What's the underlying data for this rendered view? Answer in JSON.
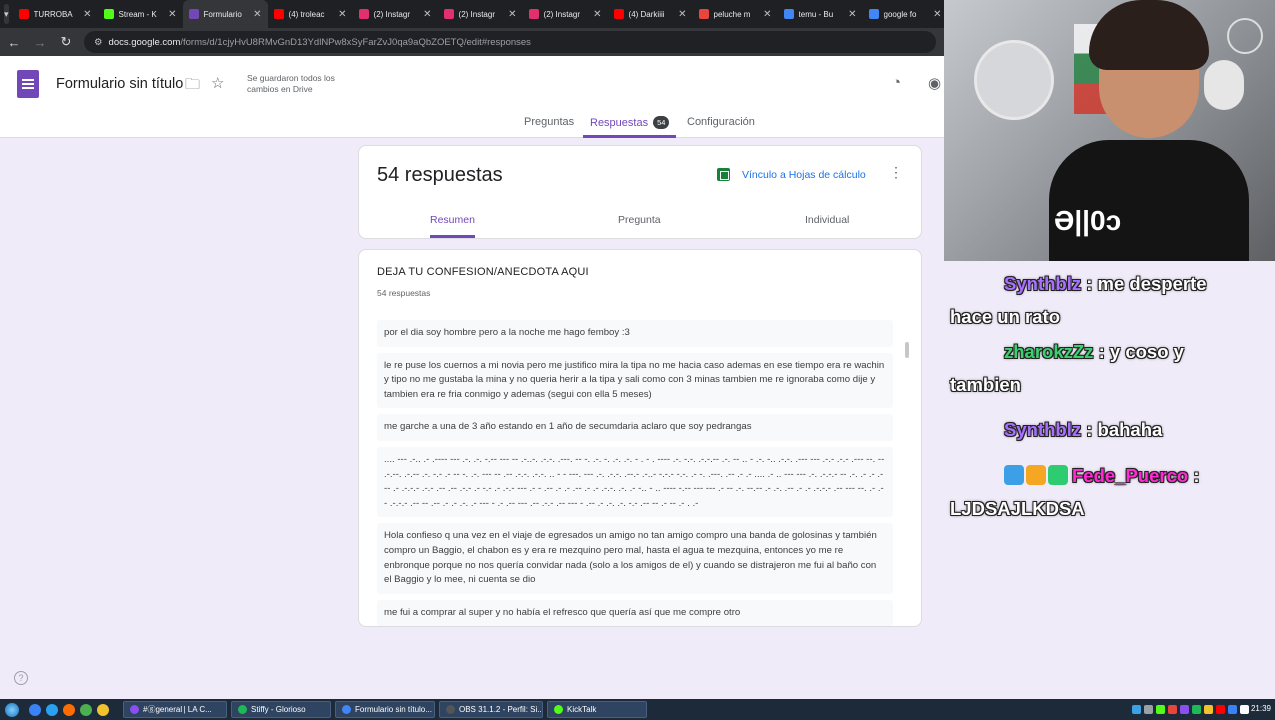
{
  "browser": {
    "tabs": [
      {
        "title": "TURROBA",
        "color": "#ff0000",
        "active": false
      },
      {
        "title": "Stream - K",
        "color": "#53fc18",
        "active": false
      },
      {
        "title": "Formulario",
        "color": "#7248b9",
        "active": true
      },
      {
        "title": "(4) troleac",
        "color": "#ff0000",
        "active": false
      },
      {
        "title": "(2) Instagr",
        "color": "#e1306c",
        "active": false
      },
      {
        "title": "(2) Instagr",
        "color": "#e1306c",
        "active": false
      },
      {
        "title": "(2) Instagr",
        "color": "#e1306c",
        "active": false
      },
      {
        "title": "(4) Darkiiii",
        "color": "#ff0000",
        "active": false
      },
      {
        "title": "peluche m",
        "color": "#e8453c",
        "active": false
      },
      {
        "title": "temu - Bu",
        "color": "#4285f4",
        "active": false
      },
      {
        "title": "google fo",
        "color": "#4285f4",
        "active": false
      }
    ],
    "url_host": "docs.google.com",
    "url_path": "/forms/d/1cjyHvU8RMvGnD13YdlNPw8xSyFarZvJ0qa9aQbZOETQ/edit#responses"
  },
  "forms_header": {
    "title": "Formulario sin título",
    "saved_note": "Se guardaron todos los cambios en Drive",
    "tabs": {
      "questions": "Preguntas",
      "responses": "Respuestas",
      "responses_badge": "54",
      "settings": "Configuración"
    }
  },
  "summary": {
    "count_label": "54 respuestas",
    "sheets_link": "Vínculo a Hojas de cálculo",
    "subtabs": {
      "summary": "Resumen",
      "question": "Pregunta",
      "individual": "Individual"
    }
  },
  "question": {
    "title": "DEJA TU CONFESION/ANECDOTA AQUI",
    "count": "54 respuestas",
    "answers": [
      "por el dia soy hombre pero a la noche me hago femboy :3",
      "le re puse los cuernos a mi novia pero me justifico mira la tipa no me hacia caso ademas en ese tiempo era re wachin y tipo no me gustaba la mina y no queria herir a la tipa y sali como con 3 minas tambien me re ignoraba como dije y tambien era re fria conmigo y ademas (segui con ella 5 meses)",
      "me garche a una de 3 año estando en 1 año de secumdaria aclaro que soy pedrangas",
      ".... --- .-.. .- .---- --- .-. .-. -.-- --- -- .-..-. .-.-. .---. -- -. .-. -. .-. .-. - . - . ---- .-. -.-. .-.-.-- .-. -- .. - .-. -.. .-.-. .--- --- .-.- .-.- .--- --. -- .-.--. .-.-- .-. -.- .- -- -. .-. --- -- .-- .-.-. .-.-. .. - - ---. --- .-. .-.-. .--.- .-..- -.-.- -.-. .- -. .---. .-- .- .- .... .- .. --- --- .-. .-.-.- -- .-. .- .- .--- .- .-.-.- .-.- .-- .-- .-.- .- -.- .- .-.- --- .- - .-- .- .- .-- .- .- .-.-. .-. .- -.. - .. ---- -.-- --- --- .- -- .-. --.-- .- .-. .-- .- .- .-.-.- .-- --- --. .- .- - .-.-.- .-- -- .-- .- .- .-. .- --- - .- .-- --- .-- .-.- .-- --- - .-- .- .-. .-. -.- .-- -- .- -- .- . .-",
      "Hola confieso q una vez en el viaje de egresados un amigo no tan amigo compro una banda de golosinas y también compro un Baggio, el chabon es y era re mezquino pero mal, hasta el agua te mezquina, entonces yo me re enbronque porque no nos quería convidar nada (solo a los amigos de el) y cuando se distrajeron me fui al baño con el Baggio y lo mee, ni cuenta se dio",
      "me fui a comprar al super y no había el refresco que quería así que me compre otro"
    ]
  },
  "chat": {
    "messages": [
      {
        "user": "Synthblz",
        "sep": " : ",
        "text": "me desperte hace un rato",
        "color": "#a970ff"
      },
      {
        "user": "zharokzZz",
        "sep": " : ",
        "text": "y coso y tambien",
        "color": "#3bd16f"
      },
      {
        "user": "Synthblz",
        "sep": " : ",
        "text": "bahaha",
        "color": "#a970ff"
      },
      {
        "user": "Fede_Puerco",
        "sep": " : ",
        "text": "LJDSAJLKDSA",
        "color": "#ff2ad4",
        "badges": [
          "#3da0e6",
          "#f5a623",
          "#2ecc71"
        ]
      }
    ]
  },
  "webcam": {
    "jersey_text": "Ə||0ɔ"
  },
  "taskbar": {
    "items": [
      {
        "label": "#ⓖgeneral | LA C...",
        "color": "#8a4ff0"
      },
      {
        "label": "Stiffy - Glorioso",
        "color": "#1db954"
      },
      {
        "label": "Formulario sin título...",
        "color": "#4285f4"
      },
      {
        "label": "OBS 31.1.2 - Perfil: Si...",
        "color": "#555555"
      },
      {
        "label": "KickTalk",
        "color": "#53fc18"
      }
    ],
    "clock": "21:39"
  }
}
